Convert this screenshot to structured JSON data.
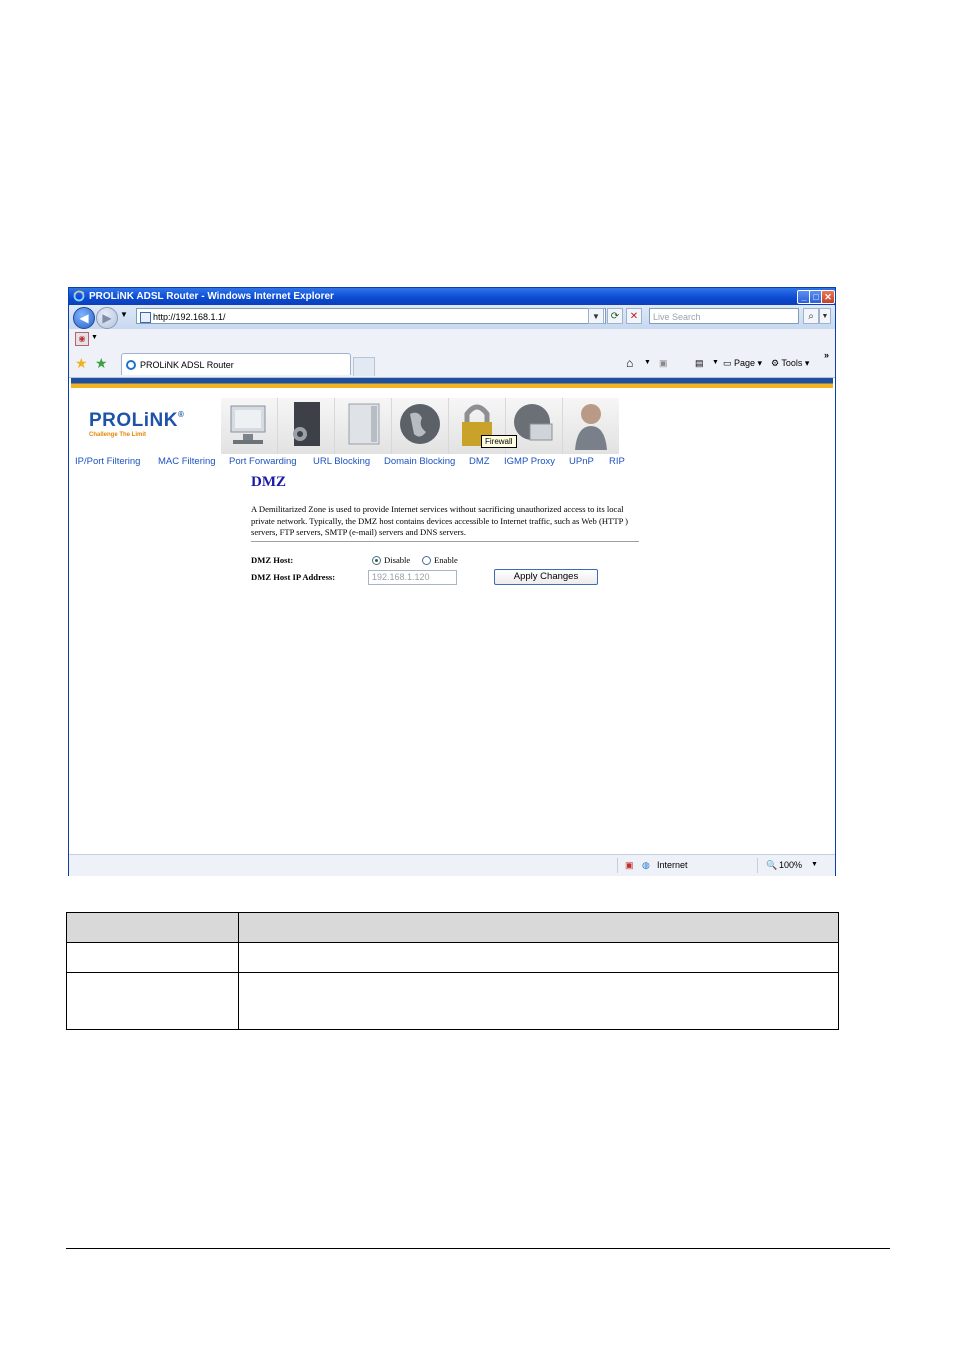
{
  "window": {
    "title": "PROLiNK ADSL Router - Windows Internet Explorer",
    "controls": [
      "minimize",
      "maximize",
      "close"
    ]
  },
  "address_bar": {
    "url": "http://192.168.1.1/",
    "search_placeholder": "Live Search"
  },
  "tab": {
    "label": "PROLiNK ADSL Router"
  },
  "command_bar": {
    "page_label": "Page",
    "tools_label": "Tools",
    "more_label": "»"
  },
  "router_page": {
    "logo": "PROLiNK",
    "logo_mark": "®",
    "tagline": "Challenge The Limit",
    "icons": [
      "status-icon",
      "setup-icon",
      "storage-icon",
      "internet-icon",
      "firewall-icon",
      "network-icon",
      "admin-icon"
    ],
    "tooltip": "Firewall",
    "subnav": [
      "IP/Port Filtering",
      "MAC Filtering",
      "Port Forwarding",
      "URL Blocking",
      "Domain Blocking",
      "DMZ",
      "IGMP Proxy",
      "UPnP",
      "RIP"
    ],
    "heading": "DMZ",
    "description": "A Demilitarized Zone is used to provide Internet services without sacrificing unauthorized access to its local private network. Typically, the DMZ host contains devices accessible to Internet traffic, such as Web (HTTP ) servers, FTP servers, SMTP (e-mail) servers and DNS servers.",
    "dmz_host_label": "DMZ Host:",
    "disable_label": "Disable",
    "enable_label": "Enable",
    "selected": "Disable",
    "ip_label": "DMZ Host IP Address:",
    "ip_value": "192.168.1.120",
    "apply_label": "Apply Changes"
  },
  "status_bar": {
    "zone": "Internet",
    "zoom": "100%"
  },
  "colors": {
    "title_bar": "#0a4ad2",
    "brand_blue": "#1d53a8",
    "brand_orange": "#f0b323",
    "link_blue": "#1d53c0",
    "heading_blue": "#1a1aa6"
  }
}
